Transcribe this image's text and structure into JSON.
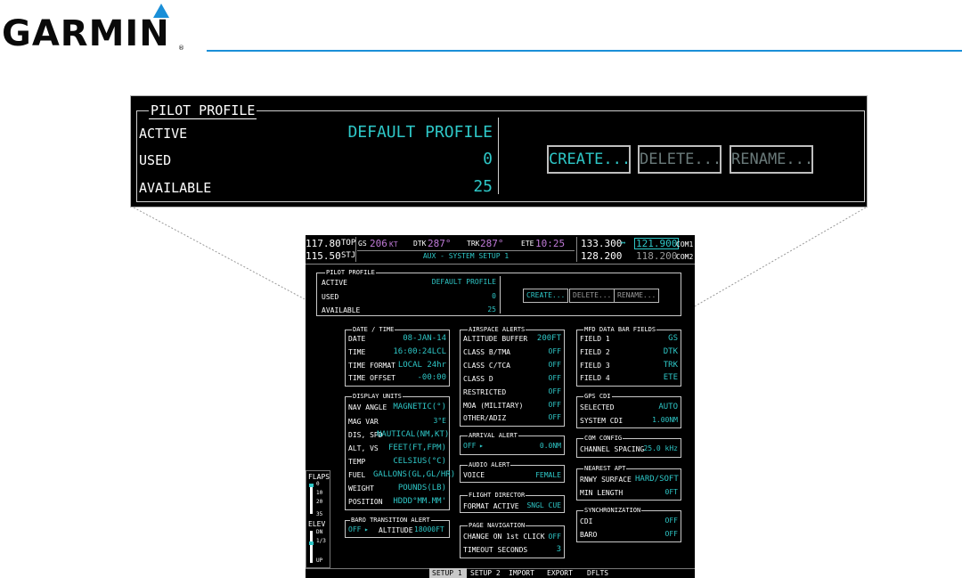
{
  "brand": {
    "logo_text": "GARMIN",
    "reg_mark": "®",
    "accent": "#1a8fd8"
  },
  "zoom_panel": {
    "title": "PILOT PROFILE",
    "rows": [
      {
        "label": "ACTIVE",
        "value": "DEFAULT PROFILE"
      },
      {
        "label": "USED",
        "value": "0"
      },
      {
        "label": "AVAILABLE",
        "value": "25"
      }
    ],
    "buttons": {
      "create": "CREATE...",
      "delete": "DELETE...",
      "rename": "RENAME..."
    }
  },
  "screen": {
    "status": {
      "nav1": "117.80",
      "nav1_id": "TOP",
      "nav2": "115.50",
      "nav2_id": "STJ",
      "gs_label": "GS",
      "gs_val": "206",
      "gs_unit": "KT",
      "dtk_label": "DTK",
      "dtk_val": "287°",
      "trk_label": "TRK",
      "trk_val": "287°",
      "ete_label": "ETE",
      "ete_val": "10:25",
      "com1_active": "133.300",
      "swap": "↔",
      "com1_standby": "121.900",
      "com1_label": "COM1",
      "com2_active": "128.200",
      "com2_standby": "118.200",
      "com2_label": "COM2",
      "page_title": "AUX - SYSTEM SETUP 1"
    },
    "pilot_profile": {
      "title": "PILOT PROFILE",
      "rows": [
        {
          "label": "ACTIVE",
          "value": "DEFAULT PROFILE"
        },
        {
          "label": "USED",
          "value": "0"
        },
        {
          "label": "AVAILABLE",
          "value": "25"
        }
      ],
      "buttons": {
        "create": "CREATE...",
        "delete": "DELETE...",
        "rename": "RENAME..."
      }
    },
    "date_time": {
      "title": "DATE / TIME",
      "rows": [
        {
          "label": "DATE",
          "value": "08-JAN-14"
        },
        {
          "label": "TIME",
          "value": "16:00:24LCL"
        },
        {
          "label": "TIME FORMAT",
          "value": "LOCAL 24hr"
        },
        {
          "label": "TIME OFFSET",
          "value": "-00:00"
        }
      ]
    },
    "display_units": {
      "title": "DISPLAY UNITS",
      "rows": [
        {
          "label": "NAV ANGLE",
          "value": "MAGNETIC(°)"
        },
        {
          "label": "MAG VAR",
          "value": "3°E"
        },
        {
          "label": "DIS, SPD",
          "value": "NAUTICAL(NM,KT)"
        },
        {
          "label": "ALT, VS",
          "value": "FEET(FT,FPM)"
        },
        {
          "label": "TEMP",
          "value": "CELSIUS(°C)"
        },
        {
          "label": "FUEL",
          "value": "GALLONS(GL,GL/HR)"
        },
        {
          "label": "WEIGHT",
          "value": "POUNDS(LB)"
        },
        {
          "label": "POSITION",
          "value": "HDDD°MM.MM'"
        }
      ]
    },
    "baro_transition": {
      "title": "BARO TRANSITION ALERT",
      "toggle": "OFF",
      "label": "ALTITUDE",
      "value": "18000FT"
    },
    "airspace_alerts": {
      "title": "AIRSPACE ALERTS",
      "rows": [
        {
          "label": "ALTITUDE BUFFER",
          "value": "200FT"
        },
        {
          "label": "CLASS B/TMA",
          "value": "OFF"
        },
        {
          "label": "CLASS C/TCA",
          "value": "OFF"
        },
        {
          "label": "CLASS D",
          "value": "OFF"
        },
        {
          "label": "RESTRICTED",
          "value": "OFF"
        },
        {
          "label": "MOA (MILITARY)",
          "value": "OFF"
        },
        {
          "label": "OTHER/ADIZ",
          "value": "OFF"
        }
      ]
    },
    "arrival_alert": {
      "title": "ARRIVAL ALERT",
      "toggle": "OFF",
      "value": "0.0NM"
    },
    "audio_alert": {
      "title": "AUDIO ALERT",
      "label": "VOICE",
      "value": "FEMALE"
    },
    "flight_director": {
      "title": "FLIGHT DIRECTOR",
      "label": "FORMAT ACTIVE",
      "value": "SNGL CUE"
    },
    "page_navigation": {
      "title": "PAGE NAVIGATION",
      "rows": [
        {
          "label": "CHANGE ON 1st CLICK",
          "value": "OFF"
        },
        {
          "label": "TIMEOUT SECONDS",
          "value": "3"
        }
      ]
    },
    "mfd_fields": {
      "title": "MFD DATA BAR FIELDS",
      "rows": [
        {
          "label": "FIELD 1",
          "value": "GS"
        },
        {
          "label": "FIELD 2",
          "value": "DTK"
        },
        {
          "label": "FIELD 3",
          "value": "TRK"
        },
        {
          "label": "FIELD 4",
          "value": "ETE"
        }
      ]
    },
    "gps_cdi": {
      "title": "GPS CDI",
      "rows": [
        {
          "label": "SELECTED",
          "value": "AUTO"
        },
        {
          "label": "SYSTEM CDI",
          "value": "1.00NM"
        }
      ]
    },
    "com_config": {
      "title": "COM CONFIG",
      "label": "CHANNEL SPACING",
      "value": "25.0 kHz"
    },
    "nearest_apt": {
      "title": "NEAREST APT",
      "rows": [
        {
          "label": "RNWY SURFACE",
          "value": "HARD/SOFT"
        },
        {
          "label": "MIN LENGTH",
          "value": "0FT"
        }
      ]
    },
    "synchronization": {
      "title": "SYNCHRONIZATION",
      "rows": [
        {
          "label": "CDI",
          "value": "OFF"
        },
        {
          "label": "BARO",
          "value": "OFF"
        }
      ]
    },
    "flaps": {
      "label": "FLAPS",
      "ticks": [
        "0",
        "10",
        "20",
        "35"
      ]
    },
    "elev": {
      "label": "ELEV",
      "ticks": [
        "DN",
        "1/3",
        "UP"
      ]
    },
    "softkeys": [
      "SETUP 1",
      "SETUP 2",
      "IMPORT",
      "EXPORT",
      "DFLTS"
    ]
  }
}
